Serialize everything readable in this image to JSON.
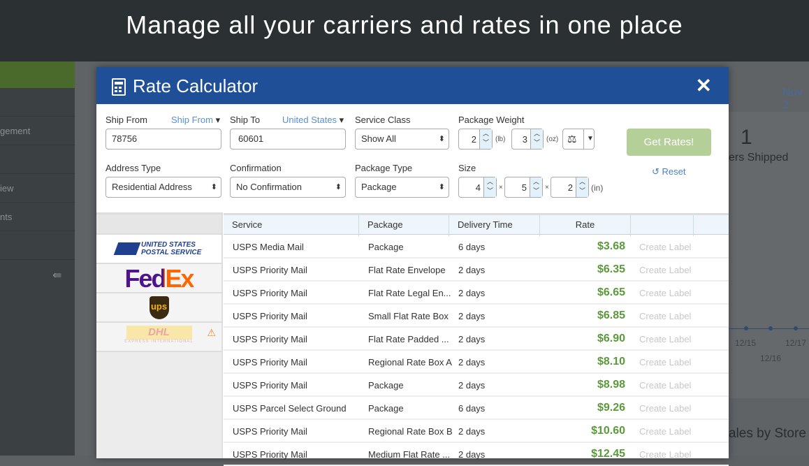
{
  "banner": {
    "title": "Manage all your carriers and rates in one place"
  },
  "sidebar": {
    "items": [
      "",
      "gement",
      "",
      "iew",
      "nts",
      ""
    ]
  },
  "background": {
    "date": "Nov 2",
    "count": "1",
    "count_label": "ers Shipped",
    "ticks": [
      "12/15",
      "12/16",
      "12/17"
    ],
    "section": "ales by Store"
  },
  "modal": {
    "title": "Rate Calculator",
    "close": "✕",
    "ship_from": {
      "label": "Ship From",
      "link": "Ship From",
      "value": "78756"
    },
    "ship_to": {
      "label": "Ship To",
      "link": "United States",
      "value": "60601"
    },
    "service_class": {
      "label": "Service Class",
      "value": "Show All"
    },
    "package_weight": {
      "label": "Package Weight",
      "lb": "2",
      "lb_unit": "(lb)",
      "oz": "3",
      "oz_unit": "(oz)"
    },
    "address_type": {
      "label": "Address Type",
      "value": "Residential Address"
    },
    "confirmation": {
      "label": "Confirmation",
      "value": "No Confirmation"
    },
    "package_type": {
      "label": "Package Type",
      "value": "Package"
    },
    "size": {
      "label": "Size",
      "l": "4",
      "w": "5",
      "h": "2",
      "unit": "(in)",
      "sep": "×"
    },
    "get_rates": "Get Rates!",
    "reset": "Reset"
  },
  "carriers": [
    {
      "name": "USPS",
      "text": "UNITED STATES POSTAL SERVICE"
    },
    {
      "name": "FedEx",
      "text": "FedEx"
    },
    {
      "name": "UPS",
      "text": "ups"
    },
    {
      "name": "DHL",
      "text": "DHL",
      "sub": "EXPRESS INTERNATIONAL",
      "warning": true
    }
  ],
  "table": {
    "headers": [
      "Service",
      "Package",
      "Delivery Time",
      "Rate",
      ""
    ],
    "rows": [
      {
        "service": "USPS Media Mail",
        "package": "Package",
        "time": "6 days",
        "rate": "$3.68",
        "action": "Create Label"
      },
      {
        "service": "USPS Priority Mail",
        "package": "Flat Rate Envelope",
        "time": "2 days",
        "rate": "$6.35",
        "action": "Create Label"
      },
      {
        "service": "USPS Priority Mail",
        "package": "Flat Rate Legal En...",
        "time": "2 days",
        "rate": "$6.65",
        "action": "Create Label"
      },
      {
        "service": "USPS Priority Mail",
        "package": "Small Flat Rate Box",
        "time": "2 days",
        "rate": "$6.85",
        "action": "Create Label"
      },
      {
        "service": "USPS Priority Mail",
        "package": "Flat Rate Padded ...",
        "time": "2 days",
        "rate": "$6.90",
        "action": "Create Label"
      },
      {
        "service": "USPS Priority Mail",
        "package": "Regional Rate Box A",
        "time": "2 days",
        "rate": "$8.10",
        "action": "Create Label"
      },
      {
        "service": "USPS Priority Mail",
        "package": "Package",
        "time": "2 days",
        "rate": "$8.98",
        "action": "Create Label"
      },
      {
        "service": "USPS Parcel Select Ground",
        "package": "Package",
        "time": "6 days",
        "rate": "$9.26",
        "action": "Create Label"
      },
      {
        "service": "USPS Priority Mail",
        "package": "Regional Rate Box B",
        "time": "2 days",
        "rate": "$10.60",
        "action": "Create Label"
      },
      {
        "service": "USPS Priority Mail",
        "package": "Medium Flat Rate ...",
        "time": "2 days",
        "rate": "$12.45",
        "action": "Create Label"
      }
    ]
  },
  "colors": {
    "header": "#1f4f97",
    "rate": "#5a9a3a",
    "button": "#b4cf98",
    "link": "#5a8fd8"
  }
}
